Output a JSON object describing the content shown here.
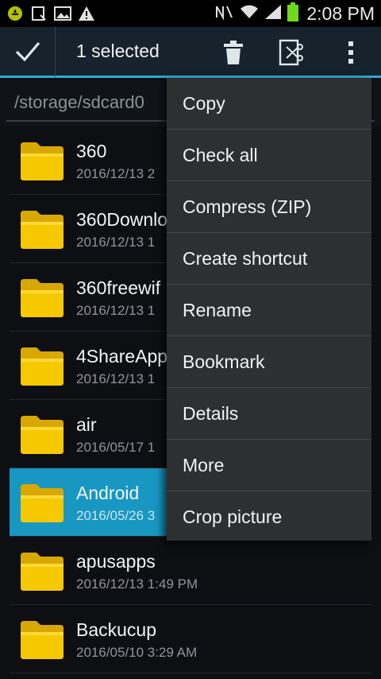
{
  "status_bar": {
    "time": "2:08 PM",
    "left_icons": [
      "app-notification-icon",
      "screenshot-icon",
      "image-icon",
      "warning-icon"
    ],
    "right_icons": [
      "nfc-icon",
      "wifi-icon",
      "signal-icon",
      "battery-icon"
    ]
  },
  "action_bar": {
    "title": "1 selected",
    "icons": [
      "check-icon",
      "delete-icon",
      "cut-icon",
      "overflow-menu-icon"
    ]
  },
  "path": "/storage/sdcard0",
  "files": [
    {
      "name": "360",
      "date": "2016/12/13 2"
    },
    {
      "name": "360Downlo",
      "date": "2016/12/13 1"
    },
    {
      "name": "360freewif",
      "date": "2016/12/13 1"
    },
    {
      "name": "4ShareApp",
      "date": "2016/12/13 1"
    },
    {
      "name": "air",
      "date": "2016/05/17 1"
    },
    {
      "name": "Android",
      "date": "2016/05/26 3",
      "selected": true
    },
    {
      "name": "apusapps",
      "date": "2016/12/13 1:49 PM"
    },
    {
      "name": "Backucup",
      "date": "2016/05/10 3:29 AM"
    }
  ],
  "menu": {
    "items": [
      "Copy",
      "Check all",
      "Compress (ZIP)",
      "Create shortcut",
      "Rename",
      "Bookmark",
      "Details",
      "More",
      "Crop picture"
    ]
  },
  "colors": {
    "accent": "#2fa9d6",
    "selected_row": "#1897c2",
    "folder": "#f2c200",
    "menu_bg": "#2e2f31"
  }
}
